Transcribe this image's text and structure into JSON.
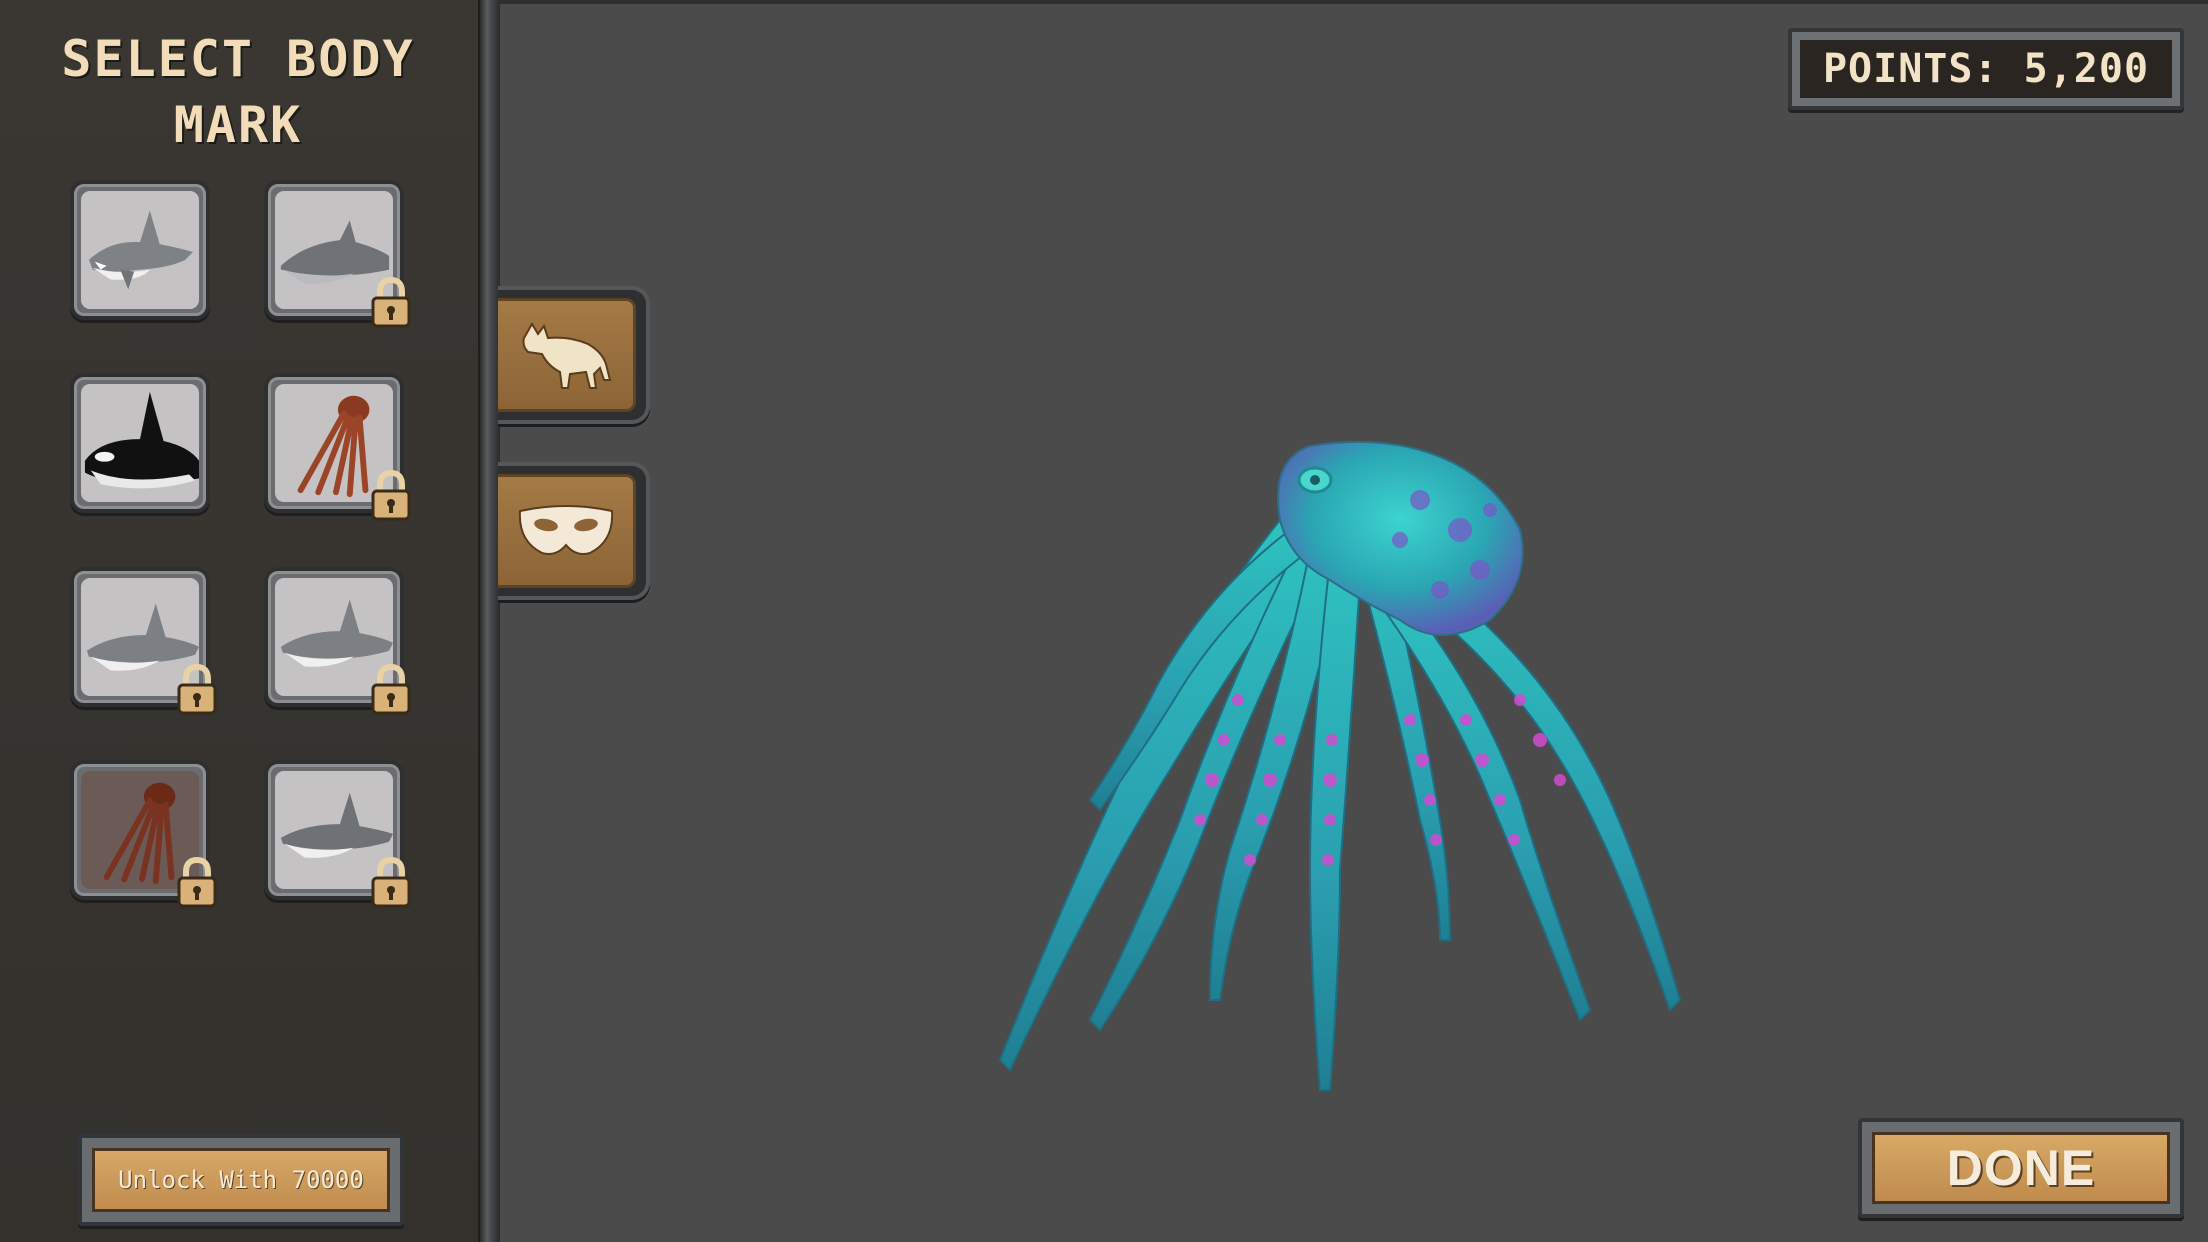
{
  "sidebar": {
    "title": "SELECT BODY MARK",
    "title_line1": "SELECT BODY",
    "title_line2": "MARK",
    "items": [
      {
        "icon": "great-white-shark-icon",
        "locked": false
      },
      {
        "icon": "dolphin-icon",
        "locked": true
      },
      {
        "icon": "orca-icon",
        "locked": false
      },
      {
        "icon": "octopus-icon",
        "locked": true
      },
      {
        "icon": "shark-icon",
        "locked": true
      },
      {
        "icon": "shark-icon",
        "locked": true
      },
      {
        "icon": "octopus-icon",
        "locked": true
      },
      {
        "icon": "hammerhead-shark-icon",
        "locked": true
      }
    ],
    "unlock_label": "Unlock With 70000"
  },
  "category_tabs": [
    {
      "icon": "wolf-icon"
    },
    {
      "icon": "mask-icon"
    }
  ],
  "points": {
    "label": "POINTS: 5,200"
  },
  "preview": {
    "model_icon": "octopus-model"
  },
  "done_label": "DONE",
  "colors": {
    "background": "#4b4b4b",
    "sidebar": "#37342f",
    "button_gold": "#c9975a",
    "octopus_body": "#1fb3b5",
    "octopus_spots": "#d24bd1"
  }
}
